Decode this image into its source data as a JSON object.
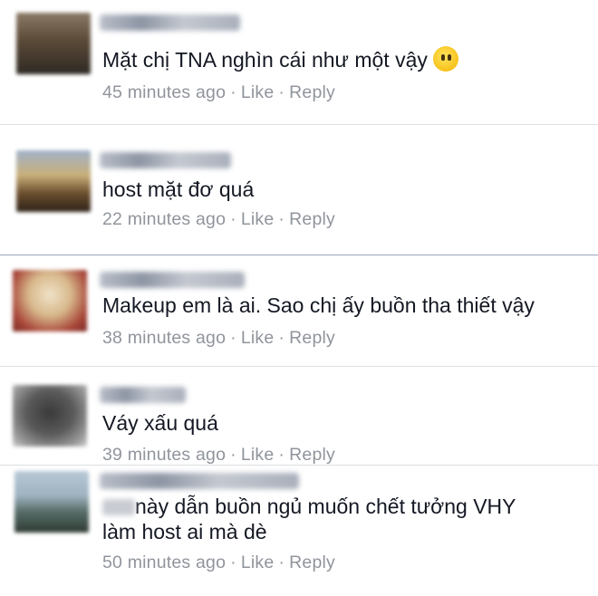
{
  "comments": [
    {
      "text": "Mặt chị TNA nghìn cái như một vậy",
      "time": "45 minutes ago",
      "like": "Like",
      "reply": "Reply",
      "emoji": "hushed-face-emoji"
    },
    {
      "text": "host mặt đơ quá",
      "time": "22 minutes ago",
      "like": "Like",
      "reply": "Reply"
    },
    {
      "text": "Makeup em là ai. Sao chị ấy buồn tha thiết vậy",
      "time": "38 minutes ago",
      "like": "Like",
      "reply": "Reply"
    },
    {
      "text": "Váy xấu quá",
      "time": "39 minutes ago",
      "like": "Like",
      "reply": "Reply"
    },
    {
      "text_line1": "này dẫn buồn ngủ muốn chết tưởng VHY",
      "text_line2": "làm host ai mà dè",
      "time": "50 minutes ago",
      "like": "Like",
      "reply": "Reply"
    }
  ],
  "separator": "·"
}
